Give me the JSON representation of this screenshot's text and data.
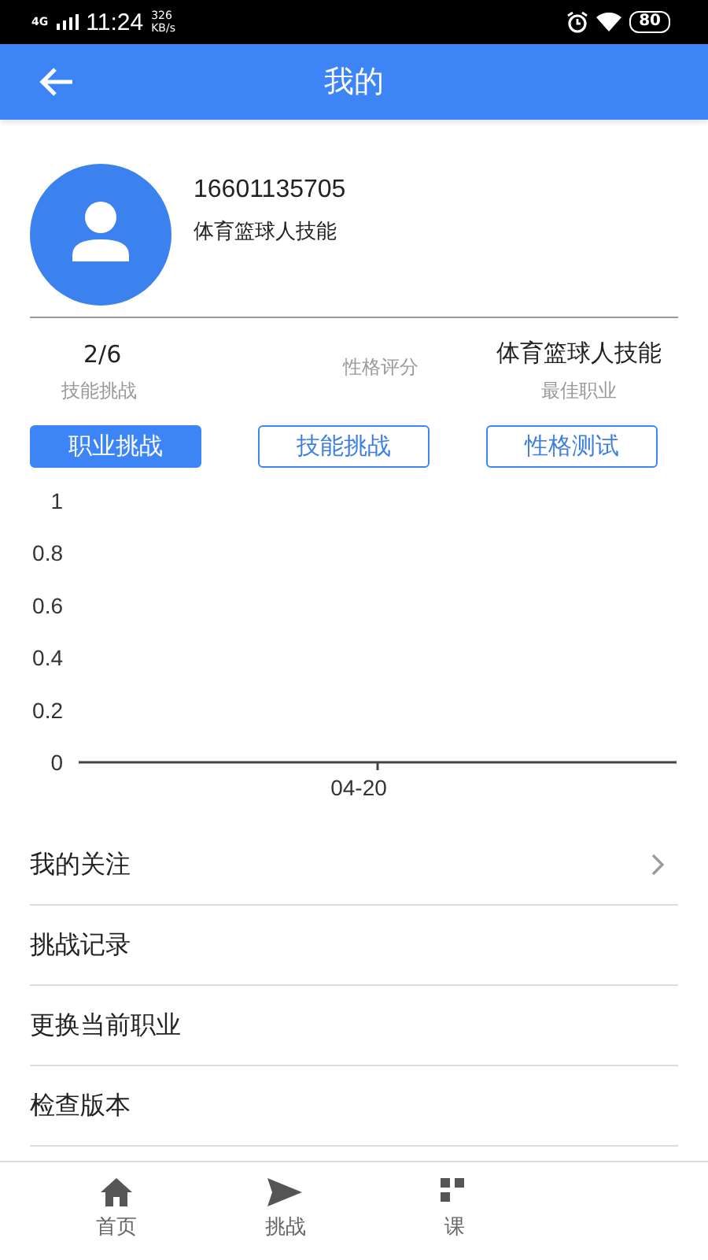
{
  "status_bar": {
    "network": "4G",
    "time": "11:24",
    "speed": "326",
    "speed_unit": "KB/s",
    "battery": "80"
  },
  "header": {
    "title": "我的"
  },
  "profile": {
    "phone": "16601135705",
    "career": "体育篮球人技能"
  },
  "stats": [
    {
      "value": "2/6",
      "label": "技能挑战"
    },
    {
      "label": "性格评分"
    },
    {
      "value": "体育篮球人技能",
      "label": "最佳职业"
    }
  ],
  "actions": [
    {
      "label": "职业挑战",
      "selected": true
    },
    {
      "label": "技能挑战",
      "selected": false
    },
    {
      "label": "性格测试",
      "selected": false
    }
  ],
  "chart_data": {
    "type": "line",
    "categories": [
      "04-20"
    ],
    "ylim": [
      0,
      1
    ],
    "yticks": [
      0,
      0.2,
      0.4,
      0.6,
      0.8,
      1
    ]
  },
  "menu": [
    {
      "label": "我的关注",
      "chevron": true
    },
    {
      "label": "挑战记录",
      "chevron": false
    },
    {
      "label": "更换当前职业",
      "chevron": false
    },
    {
      "label": "检查版本",
      "chevron": false
    }
  ],
  "tabs": [
    {
      "label": "首页",
      "kind": "home"
    },
    {
      "label": "挑战",
      "kind": "send"
    },
    {
      "label": "课",
      "kind": "grid"
    }
  ]
}
